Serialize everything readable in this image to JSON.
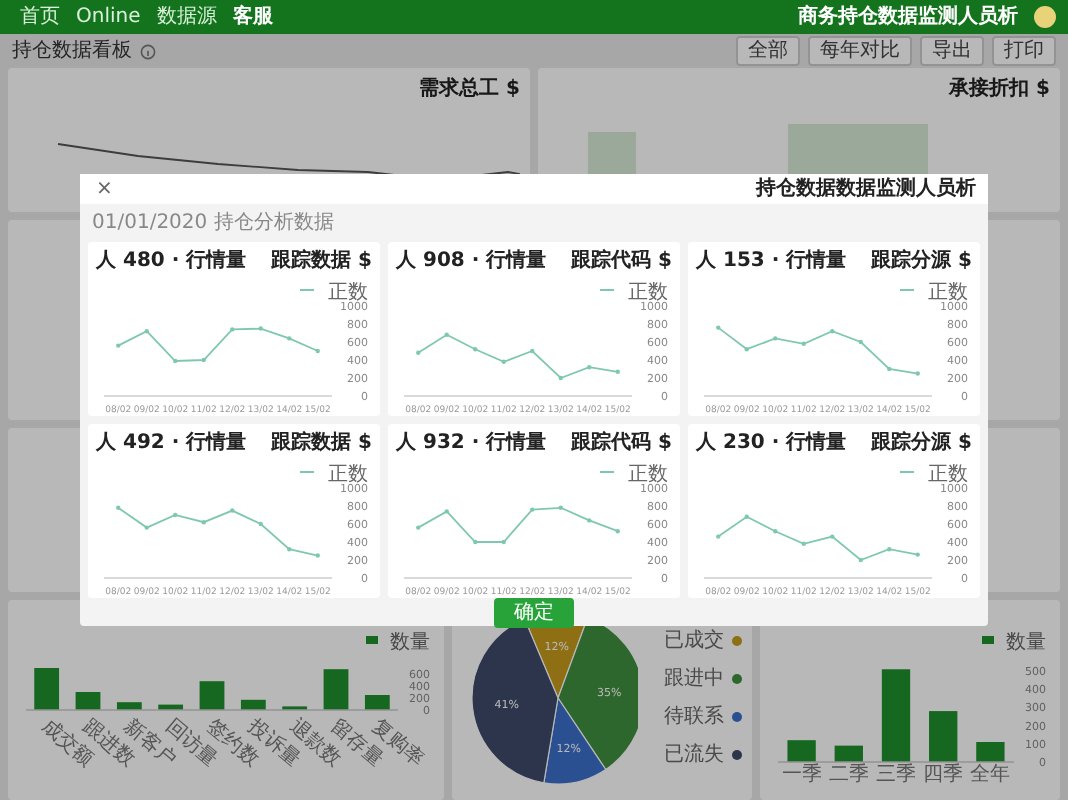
{
  "navbar": {
    "links": [
      {
        "label": "首页",
        "selected": false
      },
      {
        "label": "Online",
        "selected": false
      },
      {
        "label": "数据源",
        "selected": false
      },
      {
        "label": "客服",
        "selected": true
      }
    ],
    "title": "商务持仓数据监测人员析"
  },
  "toolbar": {
    "title": "持仓数据看板",
    "buttons": [
      "全部",
      "每年对比",
      "导出",
      "打印"
    ]
  },
  "dashboard": {
    "top_cards": [
      {
        "title": "需求总工 $",
        "kind": "line"
      },
      {
        "title": "承接折扣 $",
        "kind": "bars"
      }
    ],
    "bottom_cards": [
      {
        "chart_data": {
          "type": "bar",
          "categories": [
            "成交额",
            "跟进数",
            "新客户",
            "回访量",
            "签约数",
            "投诉量",
            "退款数",
            "留存量",
            "复购率"
          ],
          "series": [
            {
              "name": "数量",
              "color": "#1f8f2c",
              "values": [
                700,
                300,
                130,
                90,
                480,
                170,
                60,
                680,
                250
              ]
            }
          ],
          "ylim": [
            0,
            800
          ],
          "yticks": [
            0,
            200,
            400,
            600
          ]
        }
      },
      {
        "chart_data": {
          "type": "pie",
          "categories": [
            "已成交",
            "跟进中",
            "待联系",
            "已流失"
          ],
          "series": [
            {
              "values": [
                12,
                35,
                12,
                41
              ]
            }
          ],
          "colors": [
            "#c79a1c",
            "#3f8f3f",
            "#3c6fc9",
            "#3f4a6b"
          ],
          "value_labels": [
            "12%",
            "35%",
            "12%",
            "41%"
          ]
        }
      },
      {
        "chart_data": {
          "type": "bar",
          "categories": [
            "一季",
            "二季",
            "三季",
            "四季",
            "全年"
          ],
          "series": [
            {
              "name": "数量",
              "color": "#1f8f2c",
              "values": [
                120,
                90,
                510,
                280,
                110
              ]
            }
          ],
          "ylim": [
            0,
            550
          ],
          "yticks": [
            0,
            100,
            200,
            300,
            400,
            500
          ]
        }
      }
    ]
  },
  "modal": {
    "title": "持仓数据数据监测人员析",
    "close": "×",
    "breadcrumb": "01/01/2020 持仓分析数据",
    "button": "确定",
    "cards": [
      {
        "title": "人 480 · 行情量",
        "tag": "跟踪数据 $",
        "chart_data": {
          "type": "line",
          "categories": [
            "08/02",
            "09/02",
            "10/02",
            "11/02",
            "12/02",
            "13/02",
            "14/02",
            "15/02"
          ],
          "series": [
            {
              "name": "正数",
              "color": "#7fc8b0",
              "values": [
                560,
                720,
                390,
                400,
                740,
                750,
                640,
                500
              ]
            }
          ],
          "ylim": [
            0,
            1000
          ],
          "yticks": [
            0,
            200,
            400,
            600,
            800,
            1000
          ]
        }
      },
      {
        "title": "人 908 · 行情量",
        "tag": "跟踪代码 $",
        "chart_data": {
          "type": "line",
          "categories": [
            "08/02",
            "09/02",
            "10/02",
            "11/02",
            "12/02",
            "13/02",
            "14/02",
            "15/02"
          ],
          "series": [
            {
              "name": "正数",
              "color": "#7fc8b0",
              "values": [
                480,
                680,
                520,
                380,
                500,
                200,
                320,
                270
              ]
            }
          ],
          "ylim": [
            0,
            1000
          ],
          "yticks": [
            0,
            200,
            400,
            600,
            800,
            1000
          ]
        }
      },
      {
        "title": "人 153 · 行情量",
        "tag": "跟踪分源 $",
        "chart_data": {
          "type": "line",
          "categories": [
            "08/02",
            "09/02",
            "10/02",
            "11/02",
            "12/02",
            "13/02",
            "14/02",
            "15/02"
          ],
          "series": [
            {
              "name": "正数",
              "color": "#7fc8b0",
              "values": [
                760,
                520,
                640,
                580,
                720,
                600,
                300,
                250
              ]
            }
          ],
          "ylim": [
            0,
            1000
          ],
          "yticks": [
            0,
            200,
            400,
            600,
            800,
            1000
          ]
        }
      },
      {
        "title": "人 492 · 行情量",
        "tag": "跟踪数据 $",
        "chart_data": {
          "type": "line",
          "categories": [
            "08/02",
            "09/02",
            "10/02",
            "11/02",
            "12/02",
            "13/02",
            "14/02",
            "15/02"
          ],
          "series": [
            {
              "name": "正数",
              "color": "#7fc8b0",
              "values": [
                780,
                560,
                700,
                620,
                750,
                600,
                320,
                250
              ]
            }
          ],
          "ylim": [
            0,
            1000
          ],
          "yticks": [
            0,
            200,
            400,
            600,
            800,
            1000
          ]
        }
      },
      {
        "title": "人 932 · 行情量",
        "tag": "跟踪代码 $",
        "chart_data": {
          "type": "line",
          "categories": [
            "08/02",
            "09/02",
            "10/02",
            "11/02",
            "12/02",
            "13/02",
            "14/02",
            "15/02"
          ],
          "series": [
            {
              "name": "正数",
              "color": "#7fc8b0",
              "values": [
                560,
                740,
                400,
                400,
                760,
                780,
                640,
                520
              ]
            }
          ],
          "ylim": [
            0,
            1000
          ],
          "yticks": [
            0,
            200,
            400,
            600,
            800,
            1000
          ]
        }
      },
      {
        "title": "人 230 · 行情量",
        "tag": "跟踪分源 $",
        "chart_data": {
          "type": "line",
          "categories": [
            "08/02",
            "09/02",
            "10/02",
            "11/02",
            "12/02",
            "13/02",
            "14/02",
            "15/02"
          ],
          "series": [
            {
              "name": "正数",
              "color": "#7fc8b0",
              "values": [
                460,
                680,
                520,
                380,
                460,
                200,
                320,
                260
              ]
            }
          ],
          "ylim": [
            0,
            1000
          ],
          "yticks": [
            0,
            200,
            400,
            600,
            800,
            1000
          ]
        }
      }
    ]
  }
}
